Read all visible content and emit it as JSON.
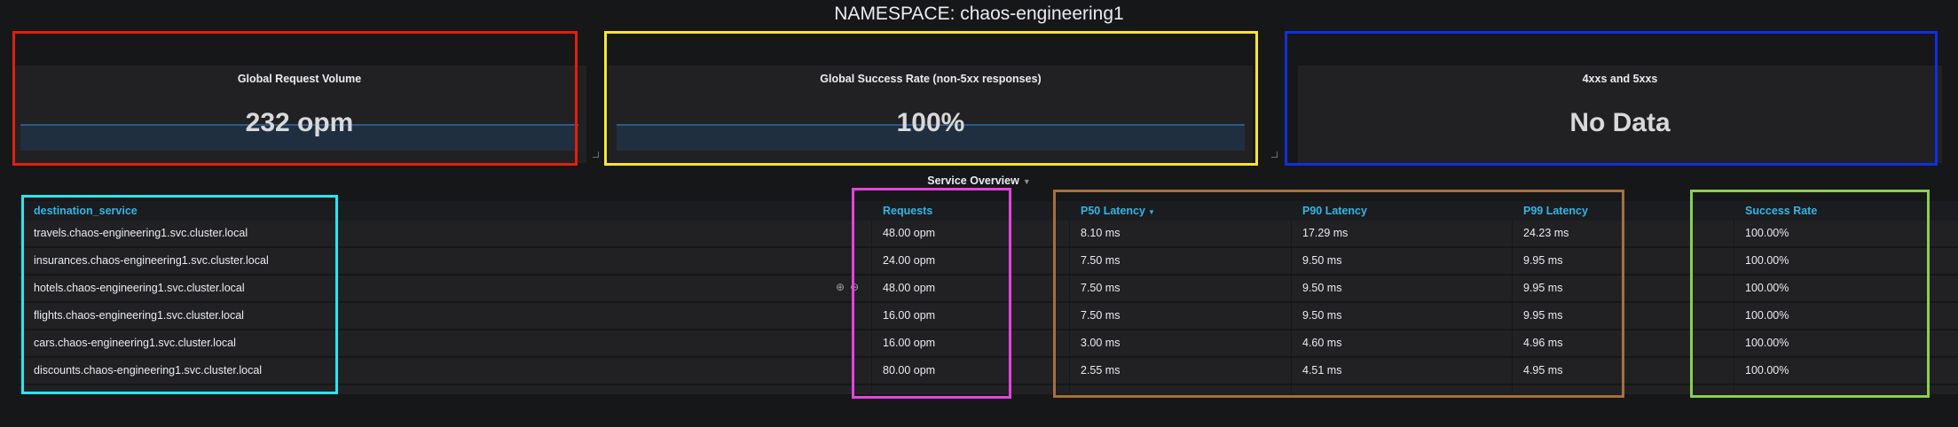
{
  "page_title": "NAMESPACE: chaos-engineering1",
  "stats": [
    {
      "title": "Global Request Volume",
      "value": "232 opm"
    },
    {
      "title": "Global Success Rate (non-5xx responses)",
      "value": "100%"
    },
    {
      "title": "4xxs and 5xxs",
      "value": "No Data"
    }
  ],
  "row_title": "Service Overview",
  "table": {
    "headers": {
      "service": "destination_service",
      "requests": "Requests",
      "p50": "P50 Latency",
      "p90": "P90 Latency",
      "p99": "P99 Latency",
      "success": "Success Rate"
    },
    "rows": [
      {
        "service": "travels.chaos-engineering1.svc.cluster.local",
        "requests": "48.00 opm",
        "p50": "8.10 ms",
        "p90": "17.29 ms",
        "p99": "24.23 ms",
        "success": "100.00%"
      },
      {
        "service": "insurances.chaos-engineering1.svc.cluster.local",
        "requests": "24.00 opm",
        "p50": "7.50 ms",
        "p90": "9.50 ms",
        "p99": "9.95 ms",
        "success": "100.00%"
      },
      {
        "service": "hotels.chaos-engineering1.svc.cluster.local",
        "requests": "48.00 opm",
        "p50": "7.50 ms",
        "p90": "9.50 ms",
        "p99": "9.95 ms",
        "success": "100.00%"
      },
      {
        "service": "flights.chaos-engineering1.svc.cluster.local",
        "requests": "16.00 opm",
        "p50": "7.50 ms",
        "p90": "9.50 ms",
        "p99": "9.95 ms",
        "success": "100.00%"
      },
      {
        "service": "cars.chaos-engineering1.svc.cluster.local",
        "requests": "16.00 opm",
        "p50": "3.00 ms",
        "p90": "4.60 ms",
        "p99": "4.96 ms",
        "success": "100.00%"
      },
      {
        "service": "discounts.chaos-engineering1.svc.cluster.local",
        "requests": "80.00 opm",
        "p50": "2.55 ms",
        "p90": "4.51 ms",
        "p99": "4.95 ms",
        "success": "100.00%"
      }
    ]
  },
  "icons": {
    "zoom_in": "zoom-in-icon",
    "zoom_out": "zoom-out-icon",
    "sort_caret": "caret-down-icon"
  },
  "colors": {
    "background": "#161719",
    "panel": "#212124",
    "header_link": "#33b5e5",
    "highlight_red": "#e0200c",
    "highlight_yellow": "#f7e826",
    "highlight_blue": "#1130d9",
    "highlight_cyan": "#29e6f0",
    "highlight_magenta": "#e445e0",
    "highlight_brown": "#a8703a",
    "highlight_green": "#8bd04a"
  }
}
